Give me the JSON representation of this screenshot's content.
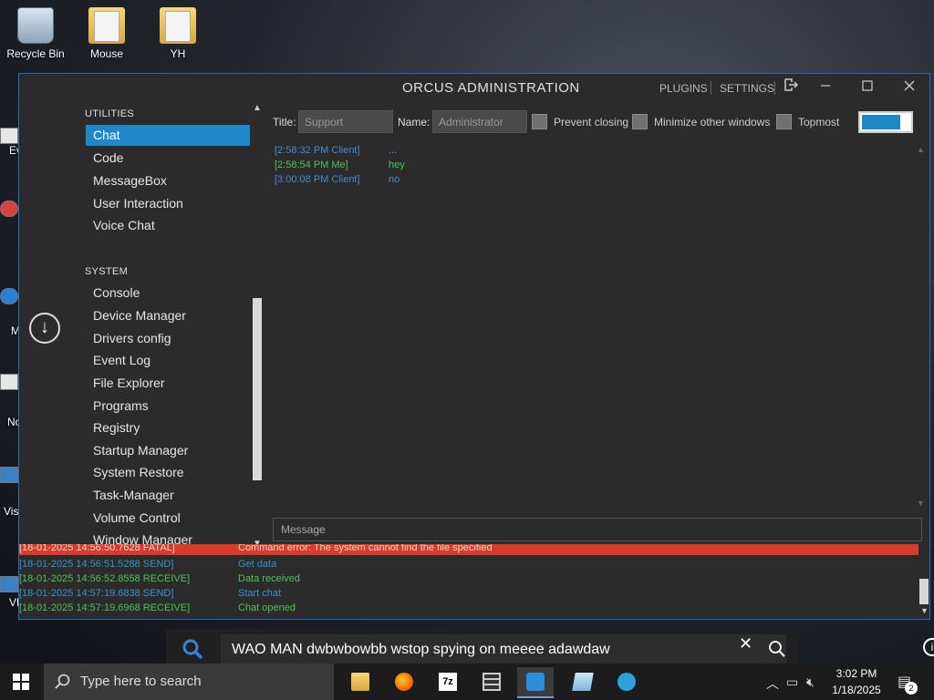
{
  "desktop": {
    "icons": [
      {
        "label": "Recycle Bin"
      },
      {
        "label": "Mouse"
      },
      {
        "label": "YH"
      }
    ],
    "edge_labels": [
      "Ev",
      "M",
      "No",
      "Vis",
      "VL"
    ]
  },
  "window": {
    "title": "ORCUS ADMINISTRATION",
    "links": {
      "plugins": "PLUGINS",
      "settings": "SETTINGS"
    }
  },
  "sidebar": {
    "utilities_header": "UTILITIES",
    "utilities": [
      {
        "label": "Chat",
        "active": true
      },
      {
        "label": "Code"
      },
      {
        "label": "MessageBox"
      },
      {
        "label": "User Interaction"
      },
      {
        "label": "Voice Chat"
      }
    ],
    "system_header": "SYSTEM",
    "system": [
      {
        "label": "Console"
      },
      {
        "label": "Device Manager"
      },
      {
        "label": "Drivers config"
      },
      {
        "label": "Event Log"
      },
      {
        "label": "File Explorer"
      },
      {
        "label": "Programs"
      },
      {
        "label": "Registry"
      },
      {
        "label": "Startup Manager"
      },
      {
        "label": "System Restore"
      },
      {
        "label": "Task-Manager"
      },
      {
        "label": "Volume Control"
      },
      {
        "label": "Window Manager"
      }
    ]
  },
  "toolbar": {
    "title_label": "Title:",
    "title_value": "Support",
    "name_label": "Name:",
    "name_value": "Administrator",
    "prevent_closing": "Prevent closing",
    "minimize_other": "Minimize other windows",
    "topmost": "Topmost"
  },
  "chat": {
    "messages": [
      {
        "time": "[2:58:32 PM Client]",
        "text": "...",
        "from": "client"
      },
      {
        "time": "[2:58:54 PM Me]",
        "text": "hey",
        "from": "me"
      },
      {
        "time": "[3:00:08 PM Client]",
        "text": "no",
        "from": "client"
      }
    ],
    "input_placeholder": "Message"
  },
  "log": {
    "rows": [
      {
        "time": "[18-01-2025 14:56:50.7628 FATAL]",
        "text": "Command error: The system cannot find the file specified",
        "level": "fatal"
      },
      {
        "time": "[18-01-2025 14:56:51.5288 SEND]",
        "text": "Get data",
        "level": "send"
      },
      {
        "time": "[18-01-2025 14:56:52.8558 RECEIVE]",
        "text": "Data received",
        "level": "receive"
      },
      {
        "time": "[18-01-2025 14:57:19.6838 SEND]",
        "text": "Start chat",
        "level": "send"
      },
      {
        "time": "[18-01-2025 14:57:19.6968 RECEIVE]",
        "text": "Chat opened",
        "level": "receive"
      }
    ]
  },
  "search_popup": {
    "text": "WAO MAN dwbwbowbb wstop spying on meeee adawdaw"
  },
  "taskbar": {
    "search_placeholder": "Type here to search",
    "clock_time": "3:02 PM",
    "clock_date": "1/18/2025",
    "notification_count": "2"
  },
  "colors": {
    "accent": "#1e88c9",
    "client": "#3a8fd6",
    "me": "#4fc34f",
    "fatal": "#d93b2b"
  }
}
